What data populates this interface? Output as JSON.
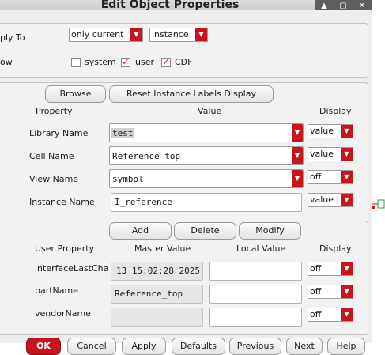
{
  "window": {
    "title": "Edit Object Properties",
    "buttons": [
      "▲",
      "▢",
      "✕"
    ]
  },
  "apply_to": {
    "label": "ply To",
    "scope": "only current",
    "type": "instance"
  },
  "show": {
    "label": "ow",
    "system_label": "system",
    "system_checked": false,
    "user_label": "user",
    "user_checked": true,
    "cdf_label": "CDF",
    "cdf_checked": true
  },
  "attributes": {
    "browse_label": "Browse",
    "reset_label": "Reset Instance Labels Display",
    "headers": {
      "property": "Property",
      "value": "Value",
      "display": "Display"
    },
    "rows": [
      {
        "label": "Library Name",
        "value": "test",
        "display": "value"
      },
      {
        "label": "Cell Name",
        "value": "Reference_top",
        "display": "value"
      },
      {
        "label": "View Name",
        "value": "symbol",
        "display": "off"
      },
      {
        "label": "Instance Name",
        "value": "I_reference",
        "display": "value"
      }
    ]
  },
  "user_props": {
    "add_label": "Add",
    "delete_label": "Delete",
    "modify_label": "Modify",
    "headers": {
      "property": "User Property",
      "master": "Master Value",
      "local": "Local Value",
      "display": "Display"
    },
    "rows": [
      {
        "label": "interfaceLastCha..",
        "master": "13 15:02:28 2025",
        "local": "",
        "display": "off"
      },
      {
        "label": "partName",
        "master": "Reference_top",
        "local": "",
        "display": "off"
      },
      {
        "label": "vendorName",
        "master": "",
        "local": "",
        "display": "off"
      }
    ]
  },
  "bottom_buttons": [
    "OK",
    "Cancel",
    "Apply",
    "Defaults",
    "Previous",
    "Next",
    "Help"
  ],
  "colors": {
    "accent": "#c8151b",
    "panel": "#f2f2f2",
    "dialog": "#eeeeee"
  },
  "icons": {
    "dropdown": "▼"
  }
}
